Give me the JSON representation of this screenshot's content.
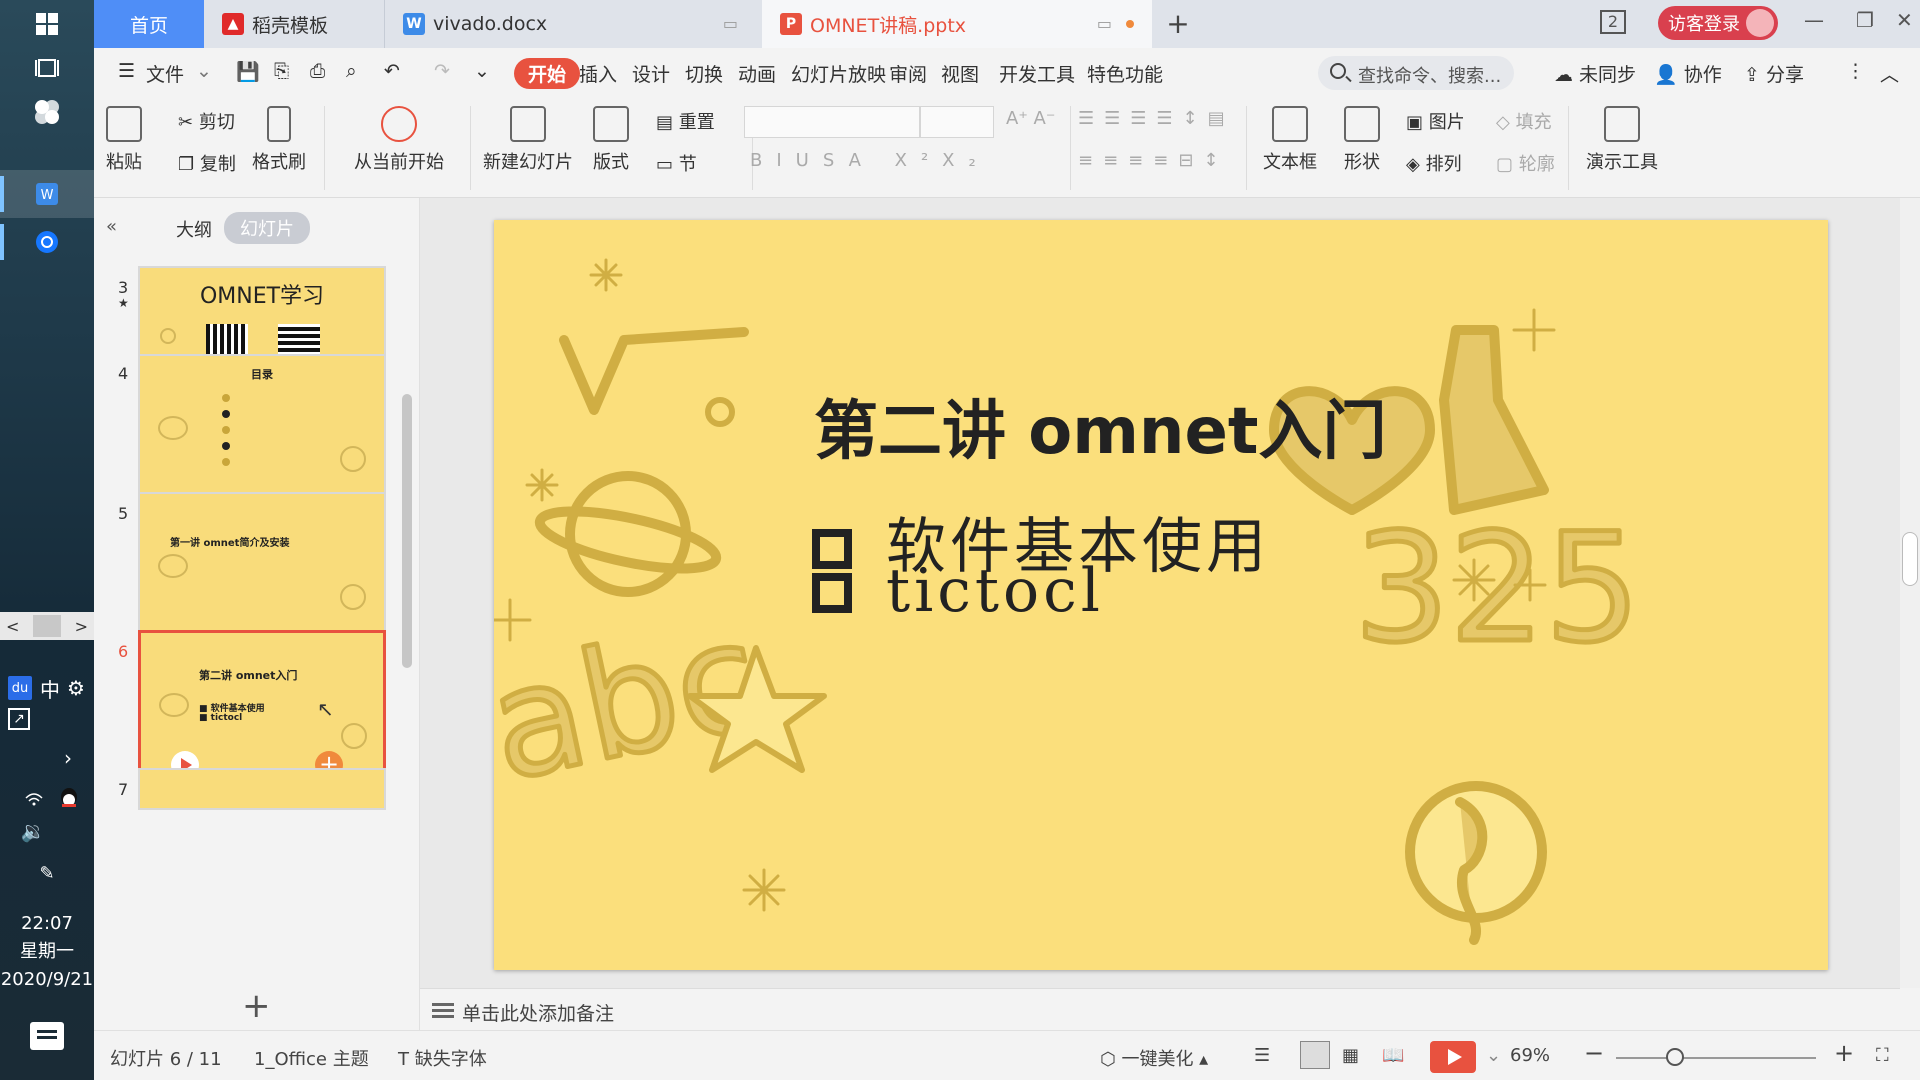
{
  "taskbar": {
    "clock_time": "22:07",
    "clock_day": "星期一",
    "clock_date": "2020/9/21",
    "ime_label": "中"
  },
  "tabs": {
    "home": "首页",
    "tab1": "稻壳模板",
    "tab2": "vivado.docx",
    "tab3": "OMNET讲稿.pptx",
    "badge": "2",
    "login": "访客登录"
  },
  "menu": {
    "file": "文件",
    "items": [
      "开始",
      "插入",
      "设计",
      "切换",
      "动画",
      "幻灯片放映",
      "审阅",
      "视图",
      "开发工具",
      "特色功能"
    ],
    "search_placeholder": "查找命令、搜索...",
    "sync": "未同步",
    "collab": "协作",
    "share": "分享"
  },
  "ribbon": {
    "paste": "粘贴",
    "cut": "剪切",
    "copy": "复制",
    "format_painter": "格式刷",
    "from_current": "从当前开始",
    "new_slide": "新建幻灯片",
    "layout": "版式",
    "reset": "重置",
    "section": "节",
    "textbox": "文本框",
    "shape": "形状",
    "picture": "图片",
    "fill": "填充",
    "arrange": "排列",
    "outline": "轮廓",
    "present_tools": "演示工具"
  },
  "sidepanel": {
    "tab_outline": "大纲",
    "tab_slides": "幻灯片",
    "thumbs": [
      {
        "num": "3",
        "title": "OMNET学习"
      },
      {
        "num": "4",
        "title": "目录"
      },
      {
        "num": "5",
        "title": "第一讲 omnet简介及安装"
      },
      {
        "num": "6",
        "title": "第二讲 omnet入门",
        "b1": "软件基本使用",
        "b2": "tictocl"
      },
      {
        "num": "7",
        "title": ""
      }
    ]
  },
  "slide": {
    "title": "第二讲 omnet入门",
    "bullets": [
      "软件基本使用",
      "tictocl"
    ]
  },
  "notes": {
    "placeholder": "单击此处添加备注"
  },
  "status": {
    "slide_count": "幻灯片 6 / 11",
    "theme": "1_Office 主题",
    "missing_font": "缺失字体",
    "beautify": "一键美化",
    "zoom": "69%"
  },
  "colors": {
    "accent": "#e8523f",
    "slide_bg": "#fbdf7c",
    "home_tab": "#4f8ef7"
  }
}
